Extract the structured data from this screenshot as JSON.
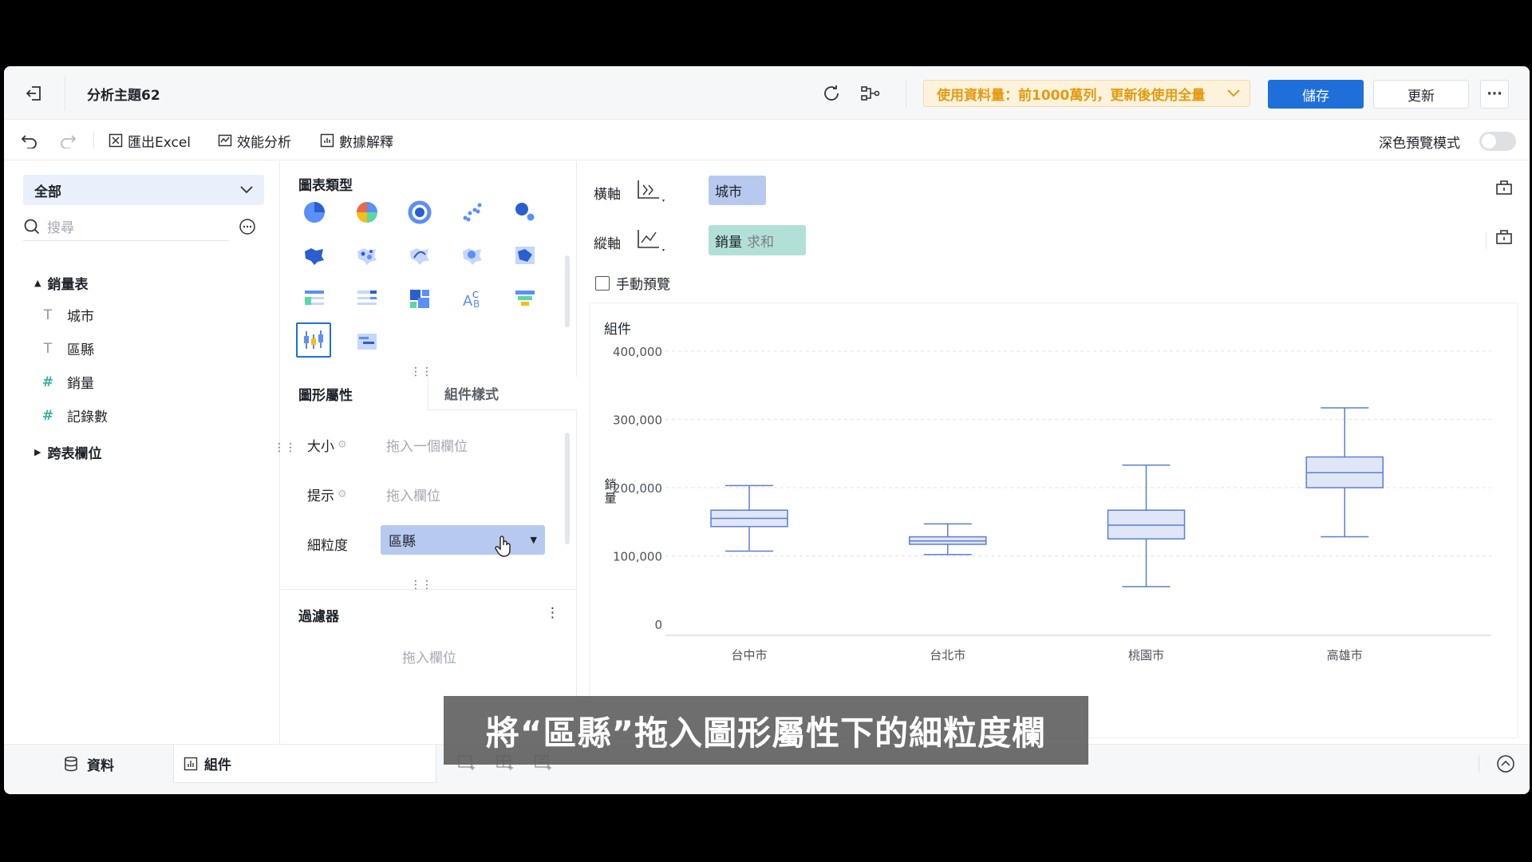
{
  "header": {
    "title": "分析主題62",
    "quota_notice": "使用資料量：前1000萬列，更新後使用全量",
    "save_label": "儲存",
    "update_label": "更新",
    "more_label": "···"
  },
  "toolbar": {
    "export_label": "匯出Excel",
    "performance_label": "效能分析",
    "explain_label": "數據解釋",
    "dark_preview_label": "深色預覽模式"
  },
  "data_panel": {
    "scope_label": "全部",
    "search_placeholder": "搜尋",
    "table_name": "銷量表",
    "fields": [
      {
        "type": "T",
        "name": "城市"
      },
      {
        "type": "T",
        "name": "區縣"
      },
      {
        "type": "#",
        "name": "銷量"
      },
      {
        "type": "#",
        "name": "記錄數"
      }
    ],
    "cross_table_label": "跨表欄位"
  },
  "config_panel": {
    "chart_type_title": "圖表類型",
    "tabs": [
      "圖形屬性",
      "組件樣式"
    ],
    "size_label": "大小",
    "size_placeholder": "拖入一個欄位",
    "tooltip_label": "提示",
    "tooltip_placeholder": "拖入欄位",
    "granularity_label": "細粒度",
    "granularity_value": "區縣",
    "filter_title": "過濾器",
    "filter_placeholder": "拖入欄位"
  },
  "axis_config": {
    "x_label": "橫軸",
    "x_field": "城市",
    "y_label": "縱軸",
    "y_field": "銷量",
    "y_agg": "求和",
    "manual_preview_label": "手動預覽"
  },
  "chart_data": {
    "type": "boxplot",
    "title": "組件",
    "ylabel": "銷量",
    "ylim": [
      0,
      400000
    ],
    "yticks": [
      "0",
      "100,000",
      "200,000",
      "300,000",
      "400,000"
    ],
    "categories": [
      "台中市",
      "台北市",
      "桃園市",
      "高雄市"
    ],
    "series": [
      {
        "min": 107000,
        "q1": 143000,
        "median": 155000,
        "q3": 167000,
        "max": 203000
      },
      {
        "min": 102000,
        "q1": 117000,
        "median": 122000,
        "q3": 128000,
        "max": 147000
      },
      {
        "min": 55000,
        "q1": 125000,
        "median": 145000,
        "q3": 167000,
        "max": 233000
      },
      {
        "min": 128000,
        "q1": 200000,
        "median": 222000,
        "q3": 245000,
        "max": 317000
      }
    ],
    "grid": true
  },
  "bottom": {
    "data_tab": "資料",
    "component_tab": "組件"
  },
  "subtitle": "將“區縣”拖入圖形屬性下的細粒度欄",
  "colors": {
    "primary": "#1f6fdb",
    "box_fill": "#dfe6f8",
    "box_stroke": "#5b7fd1",
    "field_x": "#b8c9ef",
    "field_y": "#b2e0d7",
    "notice_bg": "#fdf3dd",
    "notice_text": "#e59a0f"
  }
}
